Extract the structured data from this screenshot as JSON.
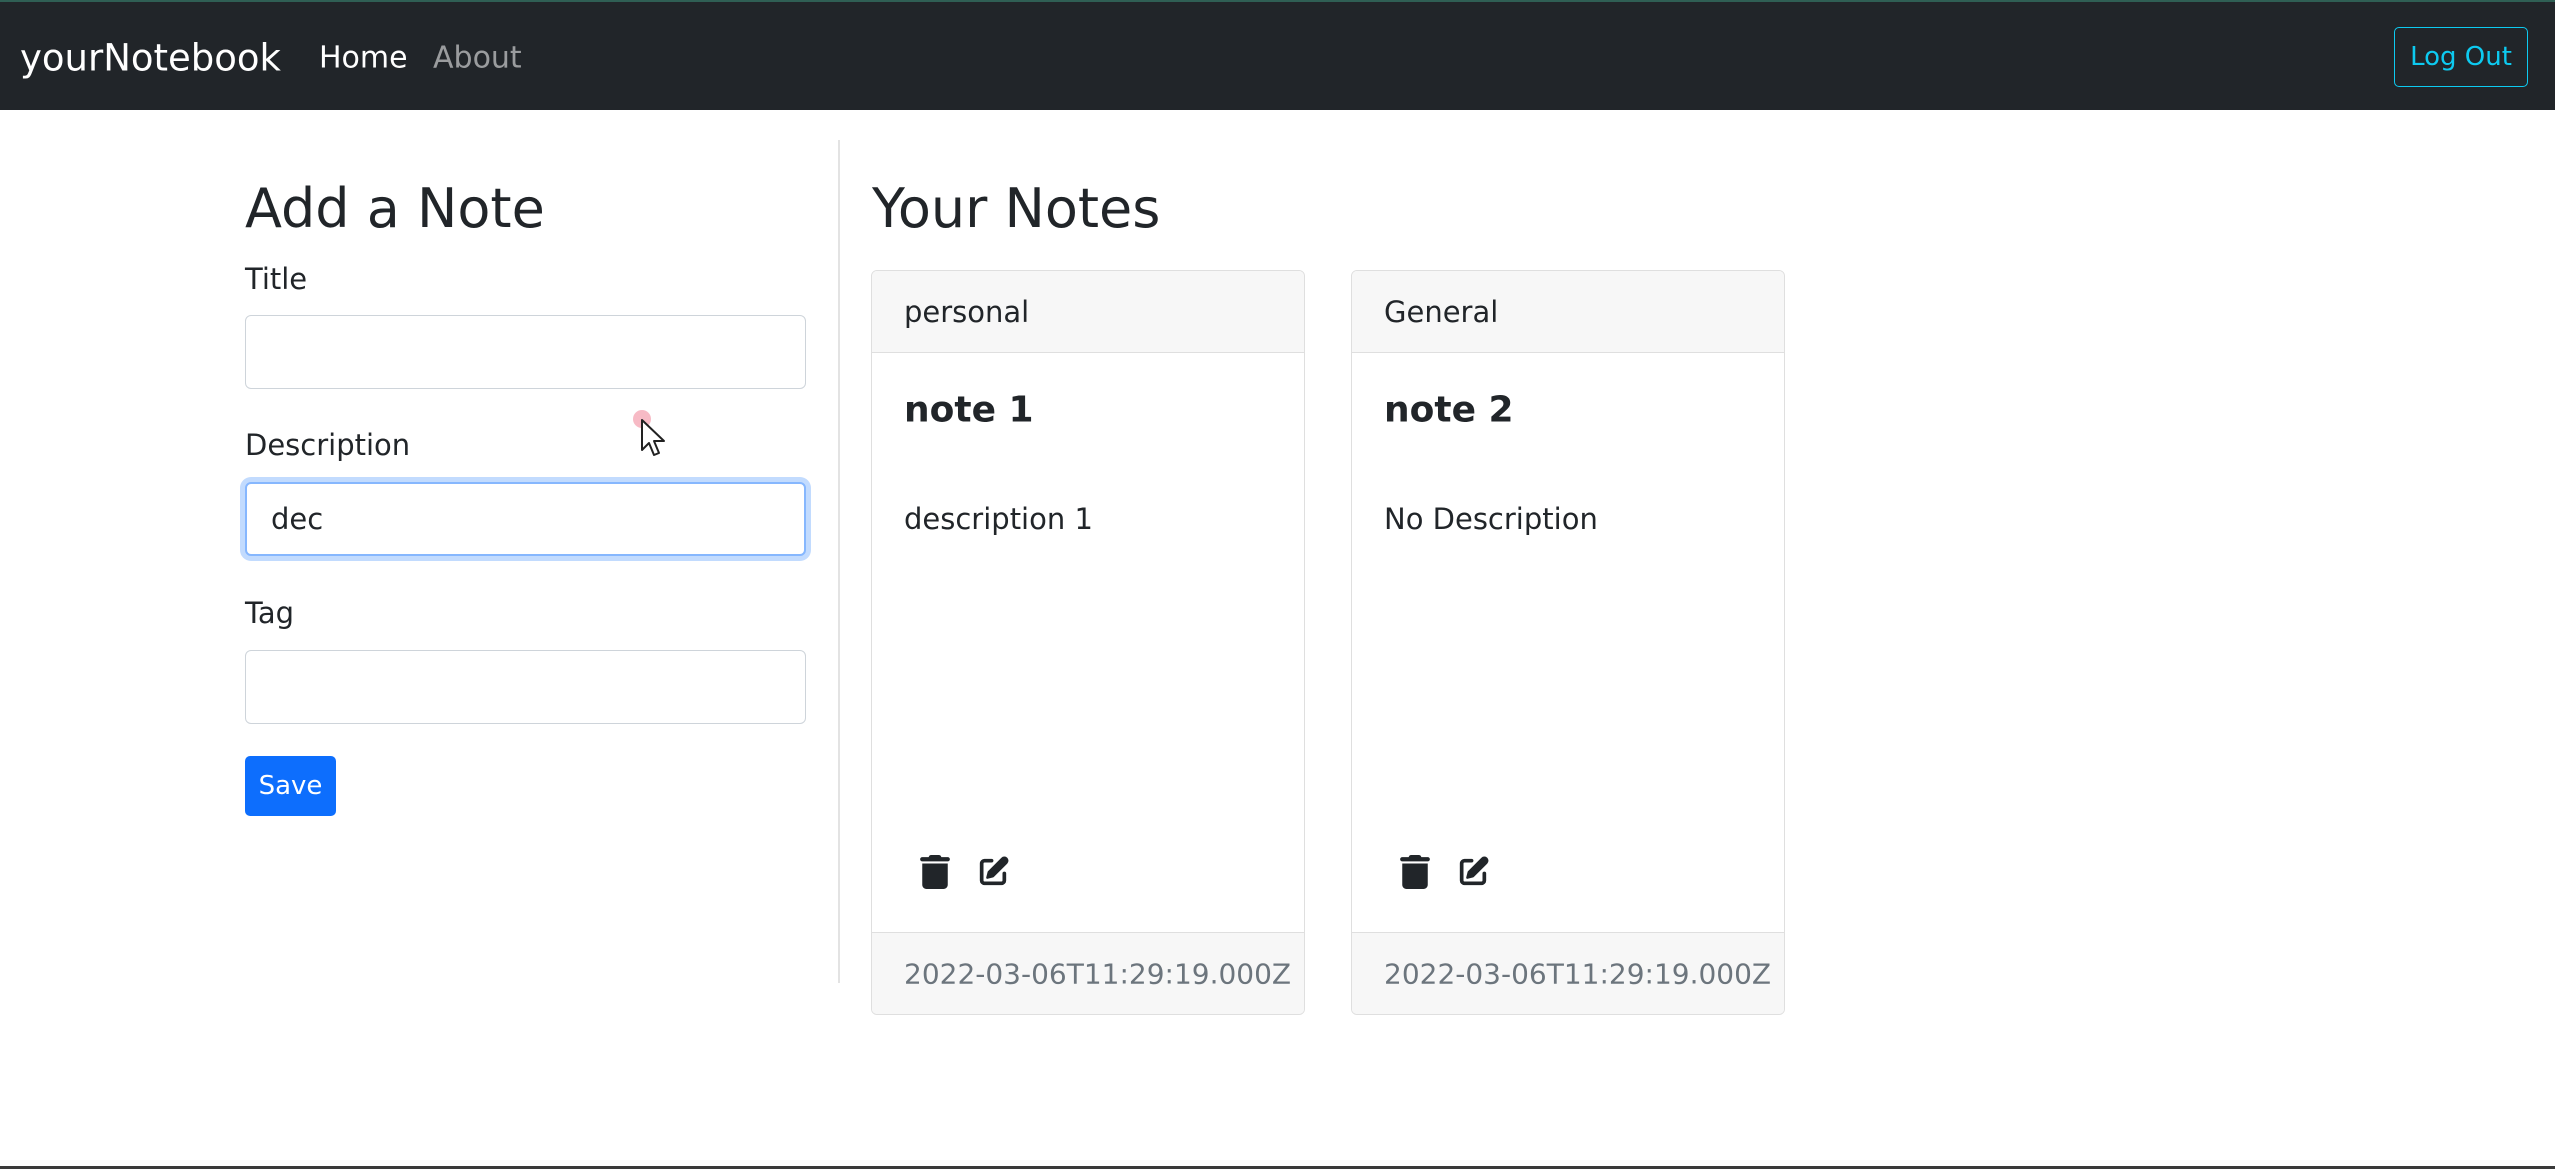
{
  "navbar": {
    "brand": "yourNotebook",
    "links": [
      {
        "label": "Home",
        "active": true
      },
      {
        "label": "About",
        "active": false
      }
    ],
    "logout_label": "Log Out",
    "background": "#212529",
    "logout_color": "#0dcaf0"
  },
  "form": {
    "heading": "Add a Note",
    "title_label": "Title",
    "title_value": "",
    "description_label": "Description",
    "description_value": "dec",
    "tag_label": "Tag",
    "tag_value": "",
    "save_label": "Save",
    "save_color": "#0d6efd"
  },
  "notes": {
    "heading": "Your Notes",
    "items": [
      {
        "tag": "personal",
        "title": "note 1",
        "description": "description 1",
        "date": "2022-03-06T11:29:19.000Z",
        "icons": [
          "trash-icon",
          "edit-icon"
        ]
      },
      {
        "tag": "General",
        "title": "note 2",
        "description": "No Description",
        "date": "2022-03-06T11:29:19.000Z",
        "icons": [
          "trash-icon",
          "edit-icon"
        ]
      }
    ]
  }
}
